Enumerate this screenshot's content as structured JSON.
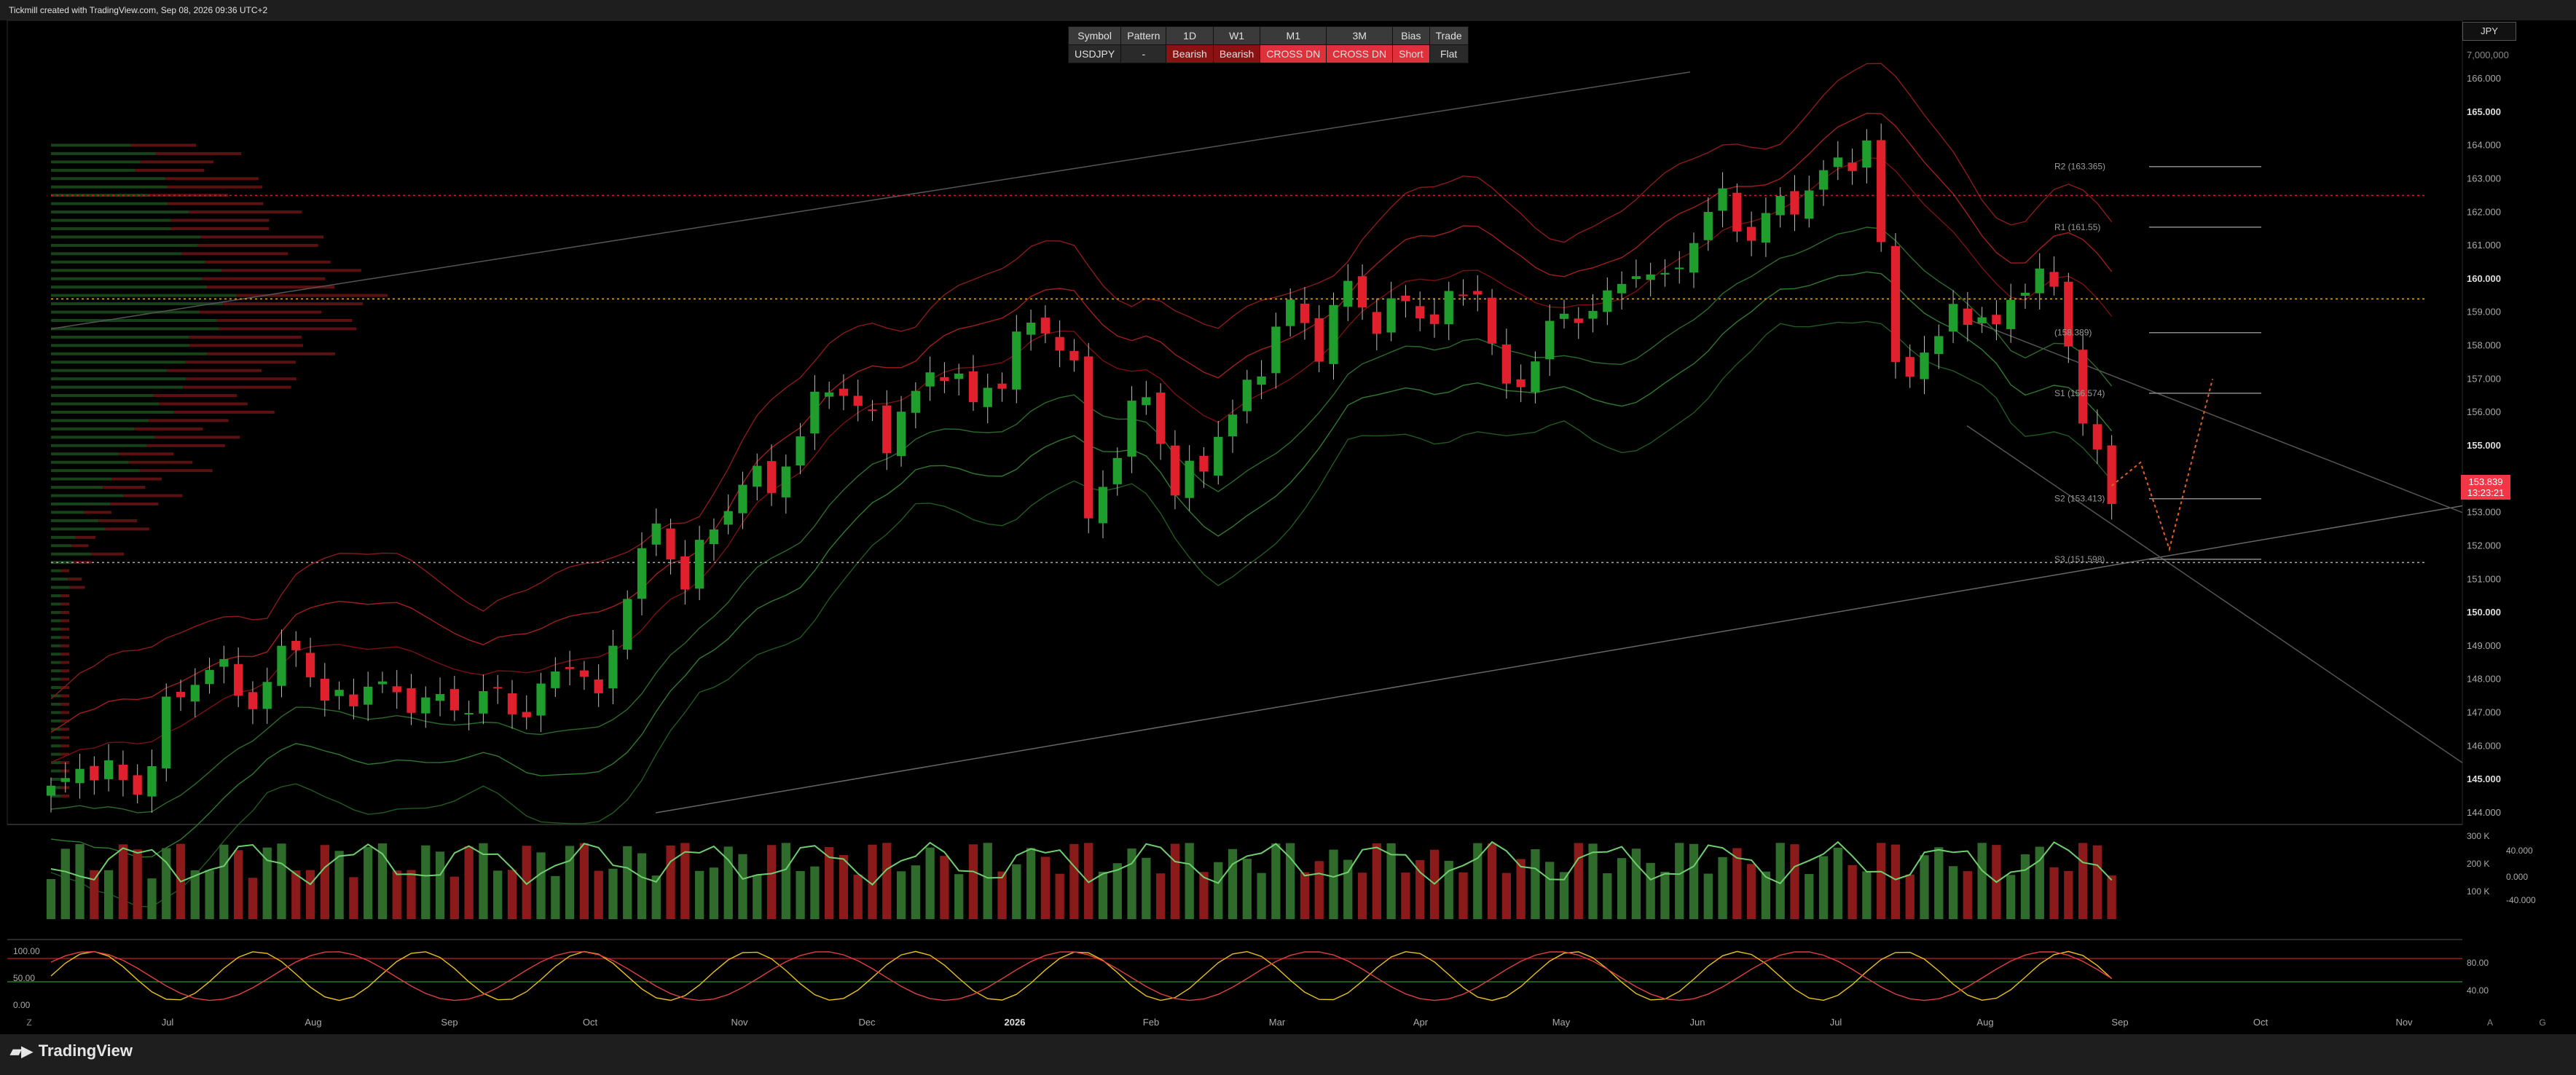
{
  "header": {
    "title": "Tickmill created with TradingView.com, Sep 08, 2026 09:36 UTC+2"
  },
  "footer": {
    "brand": "TradingView",
    "left_marker": "Z",
    "right_markers": [
      "A",
      "G"
    ]
  },
  "currency": "JPY",
  "table": {
    "headers": [
      "Symbol",
      "Pattern",
      "1D",
      "W1",
      "M1",
      "3M",
      "Bias",
      "Trade"
    ],
    "values": [
      "USDJPY",
      "-",
      "Bearish",
      "Bearish",
      "CROSS DN",
      "CROSS DN",
      "Short",
      "Flat"
    ]
  },
  "last_price": {
    "value": "153.839",
    "countdown": "13:23:21"
  },
  "colors": {
    "bull": "#1f9e2e",
    "bear": "#e0202c",
    "bg": "#000000",
    "volume_bull": "#2f6b2a",
    "volume_bear": "#8b1a1a"
  },
  "chart_data": [
    {
      "type": "candlestick",
      "symbol": "USDJPY",
      "timeframe": "1D",
      "title": "",
      "x_labels": [
        "Jul",
        "Aug",
        "Sep",
        "Oct",
        "Nov",
        "Dec",
        "2026",
        "Feb",
        "Mar",
        "Apr",
        "May",
        "Jun",
        "Jul",
        "Aug",
        "Sep",
        "Oct",
        "Nov"
      ],
      "y_ticks": [
        "166.000",
        "165.000",
        "164.000",
        "163.000",
        "162.000",
        "161.000",
        "160.000",
        "159.000",
        "158.000",
        "157.000",
        "156.000",
        "155.000",
        "154.000",
        "153.000",
        "152.000",
        "151.000",
        "150.000",
        "149.000",
        "148.000",
        "147.000",
        "146.000",
        "145.000",
        "144.000"
      ],
      "y_top_label": "7,000,000",
      "ylim": [
        144,
        166
      ],
      "close_path": [
        [
          0,
          144.6
        ],
        [
          3,
          145.5
        ],
        [
          6,
          144.6
        ],
        [
          8,
          147.0
        ],
        [
          11,
          148.5
        ],
        [
          14,
          147.3
        ],
        [
          17,
          149.2
        ],
        [
          19,
          147.2
        ],
        [
          22,
          147.8
        ],
        [
          25,
          147.4
        ],
        [
          28,
          147.2
        ],
        [
          31,
          147.5
        ],
        [
          33,
          147.0
        ],
        [
          36,
          148.7
        ],
        [
          38,
          147.3
        ],
        [
          40,
          150.8
        ],
        [
          42,
          152.5
        ],
        [
          44,
          151.0
        ],
        [
          46,
          152.5
        ],
        [
          48,
          154.0
        ],
        [
          50,
          153.8
        ],
        [
          52,
          155.3
        ],
        [
          54,
          157.0
        ],
        [
          56,
          156.1
        ],
        [
          58,
          155.3
        ],
        [
          60,
          156.5
        ],
        [
          62,
          157.5
        ],
        [
          64,
          156.2
        ],
        [
          66,
          157.2
        ],
        [
          68,
          158.7
        ],
        [
          70,
          158.2
        ],
        [
          71,
          157.0
        ],
        [
          72,
          153.0
        ],
        [
          74,
          154.8
        ],
        [
          76,
          156.8
        ],
        [
          78,
          153.5
        ],
        [
          80,
          154.7
        ],
        [
          82,
          155.8
        ],
        [
          84,
          157.6
        ],
        [
          86,
          159.2
        ],
        [
          88,
          158.0
        ],
        [
          90,
          159.8
        ],
        [
          92,
          158.7
        ],
        [
          94,
          159.3
        ],
        [
          96,
          158.8
        ],
        [
          98,
          159.6
        ],
        [
          99,
          159.8
        ],
        [
          100,
          158.0
        ],
        [
          101,
          156.5
        ],
        [
          102,
          157.0
        ],
        [
          104,
          158.5
        ],
        [
          106,
          159.0
        ],
        [
          108,
          159.3
        ],
        [
          110,
          160.4
        ],
        [
          112,
          159.8
        ],
        [
          114,
          161.3
        ],
        [
          116,
          162.4
        ],
        [
          118,
          161.2
        ],
        [
          120,
          162.3
        ],
        [
          122,
          162.5
        ],
        [
          124,
          163.6
        ],
        [
          126,
          163.8
        ],
        [
          127,
          161.0
        ],
        [
          128,
          157.6
        ],
        [
          130,
          157.3
        ],
        [
          132,
          159.4
        ],
        [
          134,
          158.3
        ],
        [
          136,
          159.5
        ],
        [
          138,
          159.8
        ],
        [
          139,
          160.2
        ],
        [
          140,
          158.0
        ],
        [
          141,
          155.6
        ],
        [
          142,
          154.5
        ],
        [
          143,
          153.8
        ]
      ],
      "bars_total": 146,
      "projection": [
        [
          143,
          153.8
        ],
        [
          145,
          154.5
        ],
        [
          147,
          151.9
        ],
        [
          150,
          157.0
        ]
      ],
      "levels": [
        {
          "label": "R2 (163.365)",
          "value": 163.365
        },
        {
          "label": "R1 (161.55)",
          "value": 161.55
        },
        {
          "label": "(158.389)",
          "value": 158.389
        },
        {
          "label": "S1 (156.574)",
          "value": 156.574
        },
        {
          "label": "S2 (153.413)",
          "value": 153.413
        },
        {
          "label": "S3 (151.598)",
          "value": 151.598
        }
      ],
      "horizontal_lines": [
        {
          "value": 162.5,
          "style": "red-dotted"
        },
        {
          "value": 159.4,
          "style": "orange-dotted"
        },
        {
          "value": 151.5,
          "style": "white-dotted"
        }
      ]
    },
    {
      "type": "bar",
      "title": "",
      "y_ticks_left": [
        "300 K",
        "200 K",
        "100 K"
      ],
      "y_ticks_right": [
        "40.000",
        "0.000",
        "-40.000"
      ]
    },
    {
      "type": "line",
      "title": "",
      "y_ticks_left": [
        "100.00",
        "50.00",
        "0.00"
      ],
      "y_ticks_right": [
        "80.00",
        "40.00"
      ],
      "levels": [
        80,
        40
      ]
    }
  ]
}
